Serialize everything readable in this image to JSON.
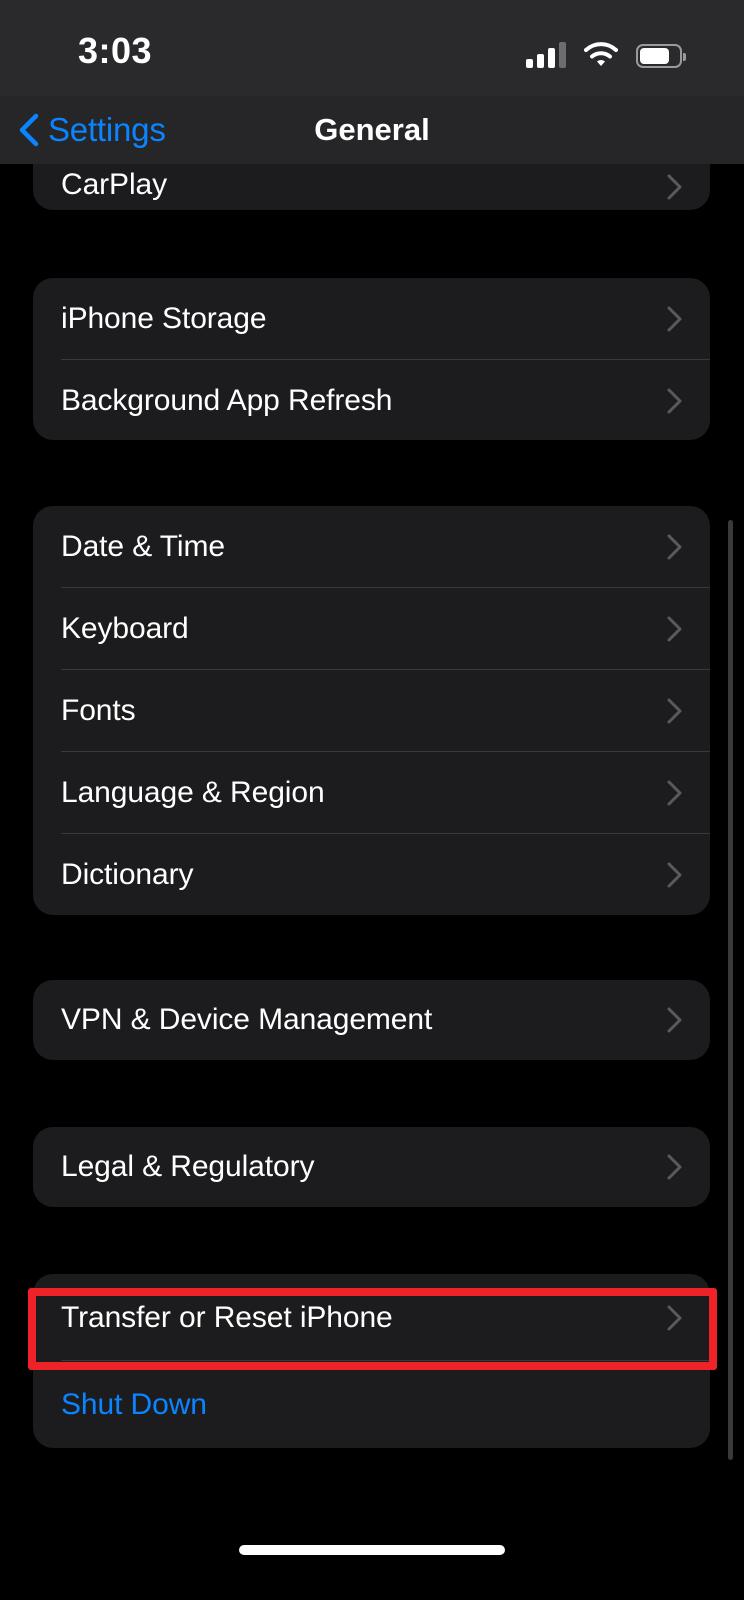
{
  "status_bar": {
    "time": "3:03",
    "cellular_icon": "cellular-bars-icon",
    "wifi_icon": "wifi-icon",
    "battery_icon": "battery-icon",
    "battery_level_pct": 75,
    "cellular_bars_active": 3,
    "cellular_bars_total": 4
  },
  "nav_bar": {
    "back_label": "Settings",
    "back_icon": "chevron-left-icon",
    "title": "General"
  },
  "colors": {
    "accent_blue": "#0a84ff",
    "highlight_red": "#ee2227",
    "row_background": "#1c1c1e",
    "page_background": "#000000",
    "chevron_gray": "#5a5a5e",
    "separator": "#39393c"
  },
  "groups": [
    {
      "id": "carplay",
      "clipped": true,
      "rows": [
        {
          "label": "CarPlay",
          "accessory": "chevron-right-icon",
          "style": "default"
        }
      ]
    },
    {
      "id": "storage",
      "rows": [
        {
          "label": "iPhone Storage",
          "accessory": "chevron-right-icon",
          "style": "default"
        },
        {
          "label": "Background App Refresh",
          "accessory": "chevron-right-icon",
          "style": "default"
        }
      ]
    },
    {
      "id": "locale",
      "rows": [
        {
          "label": "Date & Time",
          "accessory": "chevron-right-icon",
          "style": "default"
        },
        {
          "label": "Keyboard",
          "accessory": "chevron-right-icon",
          "style": "default"
        },
        {
          "label": "Fonts",
          "accessory": "chevron-right-icon",
          "style": "default"
        },
        {
          "label": "Language & Region",
          "accessory": "chevron-right-icon",
          "style": "default"
        },
        {
          "label": "Dictionary",
          "accessory": "chevron-right-icon",
          "style": "default"
        }
      ]
    },
    {
      "id": "vpn",
      "rows": [
        {
          "label": "VPN & Device Management",
          "accessory": "chevron-right-icon",
          "style": "default"
        }
      ]
    },
    {
      "id": "legal",
      "rows": [
        {
          "label": "Legal & Regulatory",
          "accessory": "chevron-right-icon",
          "style": "default"
        }
      ]
    },
    {
      "id": "reset",
      "rows": [
        {
          "label": "Transfer or Reset iPhone",
          "accessory": "chevron-right-icon",
          "style": "default",
          "highlighted": true
        },
        {
          "label": "Shut Down",
          "accessory": "none",
          "style": "blue"
        }
      ]
    }
  ],
  "annotation": {
    "type": "highlight-rectangle",
    "target_label": "Transfer or Reset iPhone",
    "color": "#ee2227"
  },
  "home_indicator": "home-indicator"
}
